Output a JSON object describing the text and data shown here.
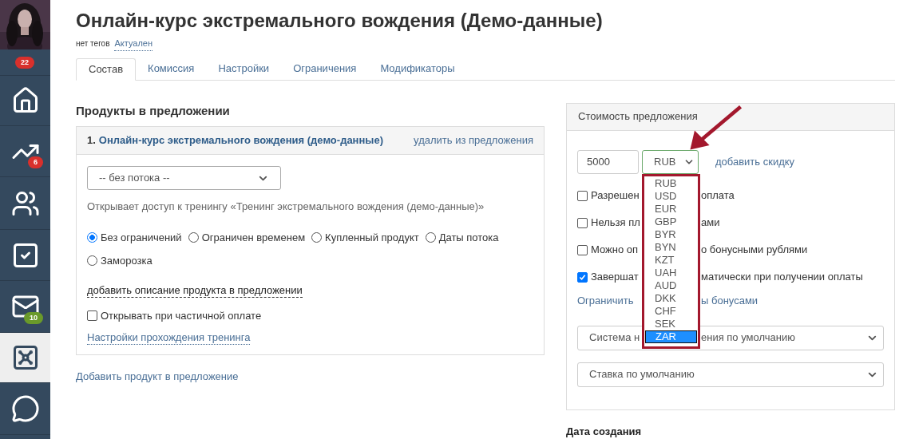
{
  "sidebar": {
    "items": [
      {
        "kind": "counter",
        "badge": "22",
        "selected": false
      },
      {
        "kind": "home",
        "selected": false
      },
      {
        "kind": "chart",
        "badge": "6",
        "selected": false
      },
      {
        "kind": "users",
        "selected": false
      },
      {
        "kind": "tasks",
        "selected": false
      },
      {
        "kind": "mail",
        "badge": "10",
        "selected": false
      },
      {
        "kind": "safe",
        "selected": true
      },
      {
        "kind": "chat",
        "selected": false
      }
    ]
  },
  "page": {
    "title": "Онлайн-курс экстремального вождения (Демо-данные)",
    "tags_label": "нет тегов",
    "status_link": "Актуален"
  },
  "tabs": [
    {
      "label": "Состав",
      "selected": true
    },
    {
      "label": "Комиссия",
      "selected": false
    },
    {
      "label": "Настройки",
      "selected": false
    },
    {
      "label": "Ограничения",
      "selected": false
    },
    {
      "label": "Модификаторы",
      "selected": false
    }
  ],
  "products": {
    "heading": "Продукты в предложении",
    "items": [
      {
        "number": "1.",
        "title": "Онлайн-курс экстремального вождения (демо-данные)",
        "remove_link": "удалить из предложения",
        "stream_select": "-- без потока --",
        "access_note": "Открывает доступ к тренингу «Тренинг экстремального вождения (демо-данные)»",
        "access_options": [
          {
            "label": "Без ограничений",
            "selected": true
          },
          {
            "label": "Ограничен временем",
            "selected": false
          },
          {
            "label": "Купленный продукт",
            "selected": false
          },
          {
            "label": "Даты потока",
            "selected": false
          },
          {
            "label": "Заморозка",
            "selected": false
          }
        ],
        "description_link": "добавить описание продукта в предложении",
        "partial_payment": {
          "label": "Открывать при частичной оплате",
          "checked": false
        },
        "settings_link": "Настройки прохождения тренинга"
      }
    ],
    "add_link": "Добавить продукт в предложение"
  },
  "price_panel": {
    "heading": "Стоимость предложения",
    "amount": "5000",
    "currency": "RUB",
    "discount_link": "добавить скидку",
    "options": [
      {
        "kind": "checkbox",
        "checked": false,
        "text_before": "Разрешен",
        "text_after": "оплата"
      },
      {
        "kind": "checkbox",
        "checked": false,
        "text_before": "Нельзя пл",
        "text_after": "ами"
      },
      {
        "kind": "checkbox",
        "checked": false,
        "text_before": "Можно оп",
        "text_after": "о бонусными рублями"
      },
      {
        "kind": "checkbox",
        "checked": true,
        "text_before": "Завершат",
        "text_after": "матически при получении оплаты"
      },
      {
        "kind": "link",
        "text_before": "Ограничить",
        "text_after": "ы бонусами"
      }
    ],
    "selects": [
      {
        "text_before": "Система н",
        "text_after": "ения по умолчанию"
      },
      {
        "text_before": "Ставка по умолчанию"
      }
    ],
    "currency_list": [
      {
        "label": "RUB",
        "selected": false
      },
      {
        "label": "USD",
        "selected": false
      },
      {
        "label": "EUR",
        "selected": false
      },
      {
        "label": "GBP",
        "selected": false
      },
      {
        "label": "BYR",
        "selected": false
      },
      {
        "label": "BYN",
        "selected": false
      },
      {
        "label": "KZT",
        "selected": false
      },
      {
        "label": "UAH",
        "selected": false
      },
      {
        "label": "AUD",
        "selected": false
      },
      {
        "label": "DKK",
        "selected": false
      },
      {
        "label": "CHF",
        "selected": false
      },
      {
        "label": "SEK",
        "selected": false
      },
      {
        "label": "ZAR",
        "selected": true
      }
    ]
  },
  "created_heading": "Дата создания"
}
